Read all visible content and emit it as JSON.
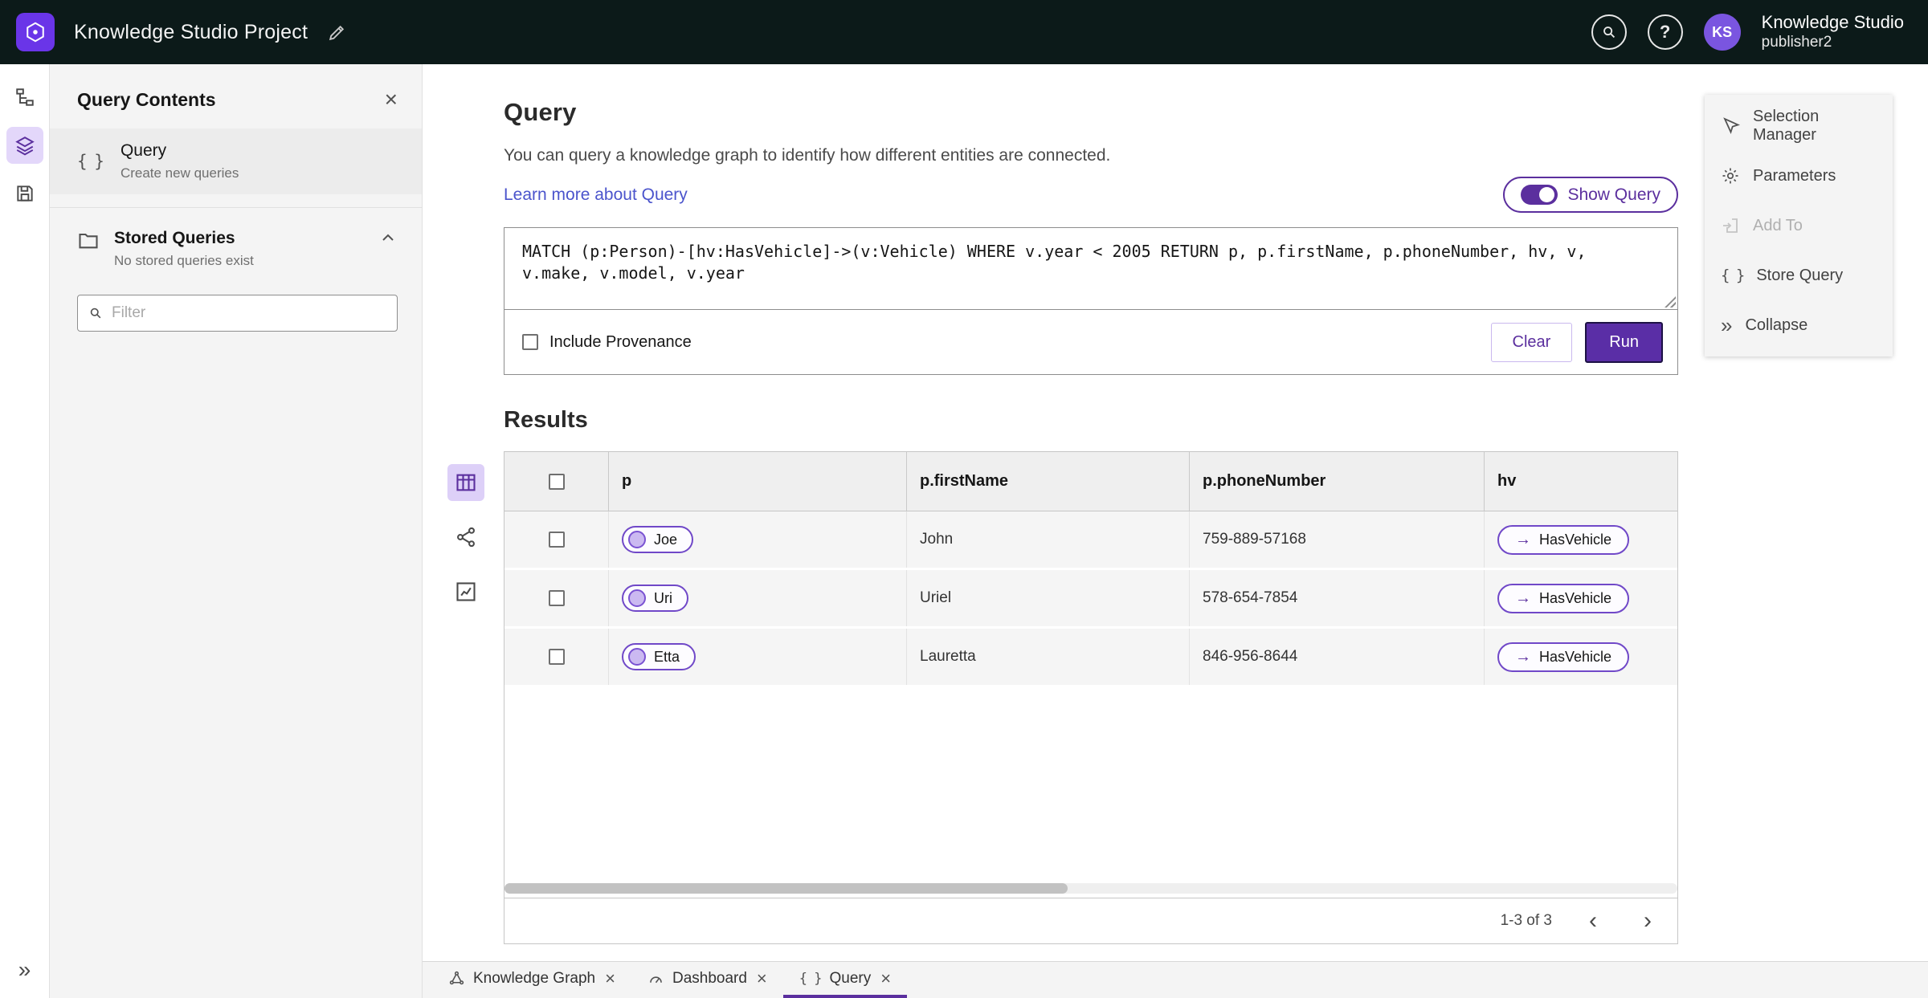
{
  "colors": {
    "accent": "#5b2f9e",
    "topbar_bg": "#0c1a19",
    "link": "#4b54cc",
    "run_button": "#5a2ea6"
  },
  "icons": {
    "close": "×",
    "braces": "{ }",
    "arrow_right": "→",
    "pager_left": "‹",
    "pager_right": "›",
    "double_chevron": "»",
    "help": "?"
  },
  "topbar": {
    "title": "Knowledge Studio Project",
    "product": "Knowledge Studio",
    "user": "publisher2",
    "avatar_initials": "KS"
  },
  "left_panel": {
    "title": "Query Contents",
    "query_item": {
      "title": "Query",
      "subtitle": "Create new queries"
    },
    "stored": {
      "title": "Stored Queries",
      "subtitle": "No stored queries exist"
    },
    "filter_placeholder": "Filter"
  },
  "main": {
    "title": "Query",
    "description": "You can query a knowledge graph to identify how different entities are connected.",
    "learn_more": "Learn more about Query",
    "show_query_label": "Show Query",
    "query_text": "MATCH (p:Person)-[hv:HasVehicle]->(v:Vehicle) WHERE v.year < 2005 RETURN p, p.firstName, p.phoneNumber, hv, v, v.make, v.model, v.year",
    "include_provenance": "Include Provenance",
    "clear_label": "Clear",
    "run_label": "Run",
    "results_title": "Results",
    "table": {
      "columns": [
        "p",
        "p.firstName",
        "p.phoneNumber",
        "hv"
      ],
      "rows": [
        {
          "p": "Joe",
          "firstName": "John",
          "phone": "759-889-57168",
          "hv": "HasVehicle"
        },
        {
          "p": "Uri",
          "firstName": "Uriel",
          "phone": "578-654-7854",
          "hv": "HasVehicle"
        },
        {
          "p": "Etta",
          "firstName": "Lauretta",
          "phone": "846-956-8644",
          "hv": "HasVehicle"
        }
      ]
    },
    "pagination": "1-3 of 3"
  },
  "context_menu": {
    "items": [
      {
        "label": "Selection Manager",
        "disabled": false
      },
      {
        "label": "Parameters",
        "disabled": false
      },
      {
        "label": "Add To",
        "disabled": true
      },
      {
        "label": "Store Query",
        "disabled": false
      },
      {
        "label": "Collapse",
        "disabled": false
      }
    ]
  },
  "tabs": [
    {
      "label": "Knowledge Graph",
      "active": false
    },
    {
      "label": "Dashboard",
      "active": false
    },
    {
      "label": "Query",
      "active": true
    }
  ]
}
